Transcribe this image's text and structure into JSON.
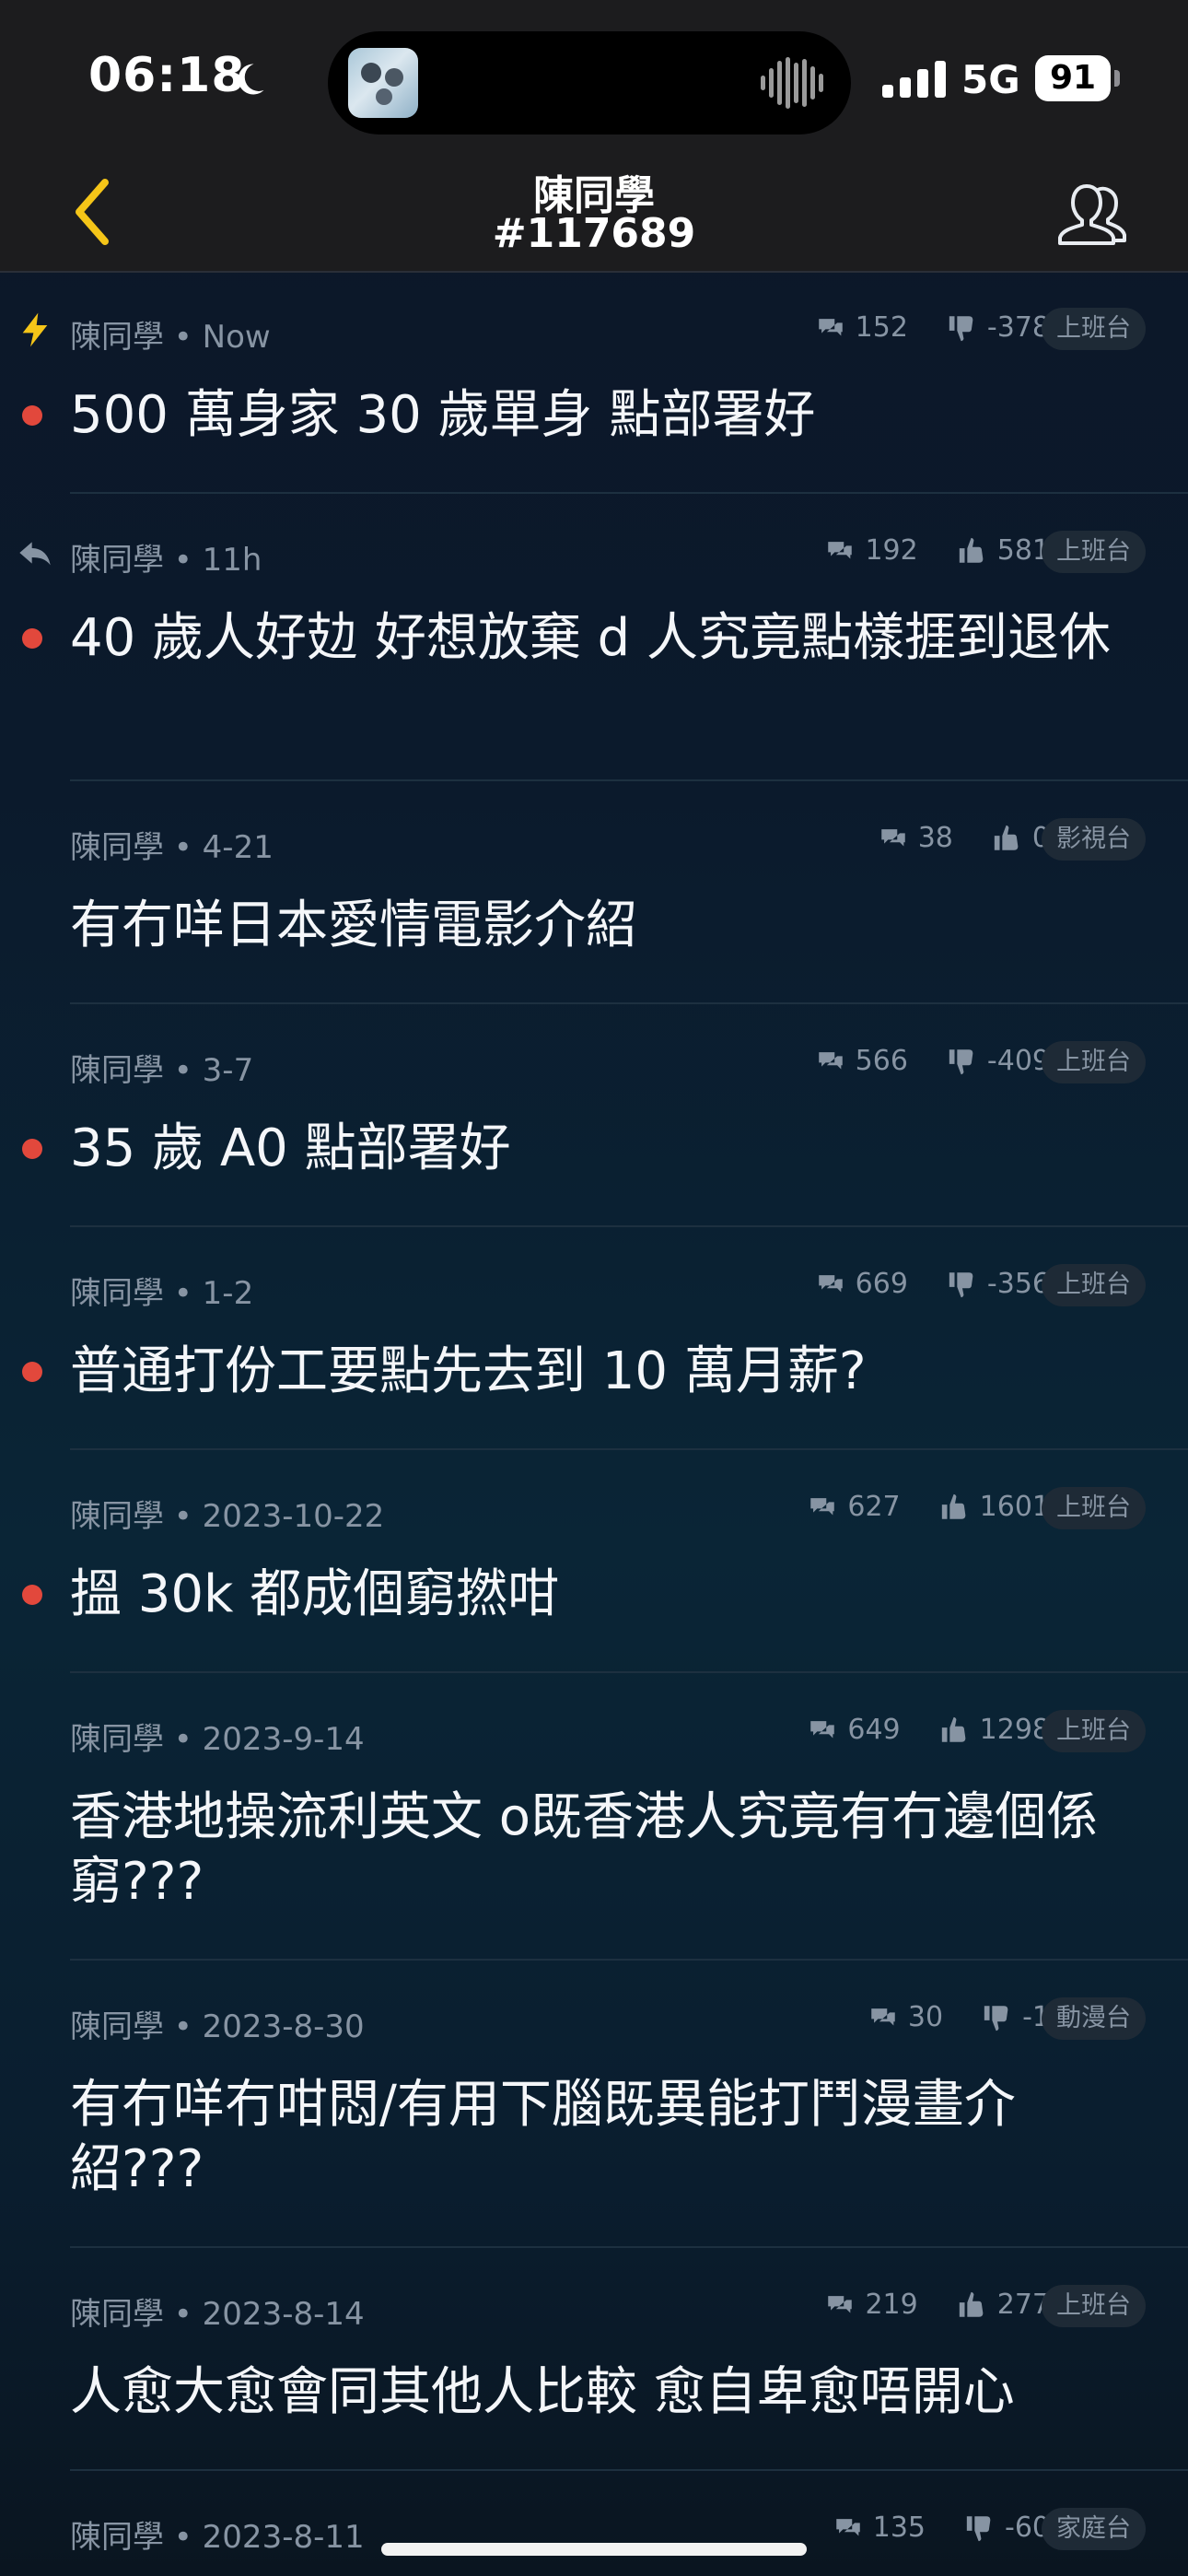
{
  "status_bar": {
    "time": "06:18",
    "network": "5G",
    "battery": "91"
  },
  "header": {
    "name": "陳同學",
    "user_id": "#117689"
  },
  "posts": [
    {
      "author": "陳同學",
      "time": "Now",
      "comments": "152",
      "score": "-378",
      "vote": "down",
      "board": "上班台",
      "title": "500 萬身家 30 歲單身 點部署好",
      "unread": true,
      "lead_icon": "lightning-icon"
    },
    {
      "author": "陳同學",
      "time": "11h",
      "comments": "192",
      "score": "581",
      "vote": "up",
      "board": "上班台",
      "title": "40 歲人好攰 好想放棄 d 人究竟點樣捱到退休",
      "unread": true,
      "lead_icon": "reply-icon"
    },
    {
      "author": "陳同學",
      "time": "4-21",
      "comments": "38",
      "score": "0",
      "vote": "up",
      "board": "影視台",
      "title": "有冇咩日本愛情電影介紹",
      "unread": false
    },
    {
      "author": "陳同學",
      "time": "3-7",
      "comments": "566",
      "score": "-409",
      "vote": "down",
      "board": "上班台",
      "title": "35 歲 A0 點部署好",
      "unread": true
    },
    {
      "author": "陳同學",
      "time": "1-2",
      "comments": "669",
      "score": "-356",
      "vote": "down",
      "board": "上班台",
      "title": "普通打份工要點先去到 10 萬月薪?",
      "unread": true
    },
    {
      "author": "陳同學",
      "time": "2023-10-22",
      "comments": "627",
      "score": "1601",
      "vote": "up",
      "board": "上班台",
      "title": "搵 30k 都成個窮撚咁",
      "unread": true
    },
    {
      "author": "陳同學",
      "time": "2023-9-14",
      "comments": "649",
      "score": "1298",
      "vote": "up",
      "board": "上班台",
      "title": "香港地操流利英文 o既香港人究竟有冇邊個係窮???",
      "unread": false
    },
    {
      "author": "陳同學",
      "time": "2023-8-30",
      "comments": "30",
      "score": "-1",
      "vote": "down",
      "board": "動漫台",
      "title": "有冇咩冇咁悶/有用下腦既異能打鬥漫畫介紹???",
      "unread": false
    },
    {
      "author": "陳同學",
      "time": "2023-8-14",
      "comments": "219",
      "score": "277",
      "vote": "up",
      "board": "上班台",
      "title": "人愈大愈會同其他人比較 愈自卑愈唔開心",
      "unread": false
    },
    {
      "author": "陳同學",
      "time": "2023-8-11",
      "comments": "135",
      "score": "-60",
      "vote": "down",
      "board": "家庭台",
      "title": "",
      "unread": false
    }
  ]
}
